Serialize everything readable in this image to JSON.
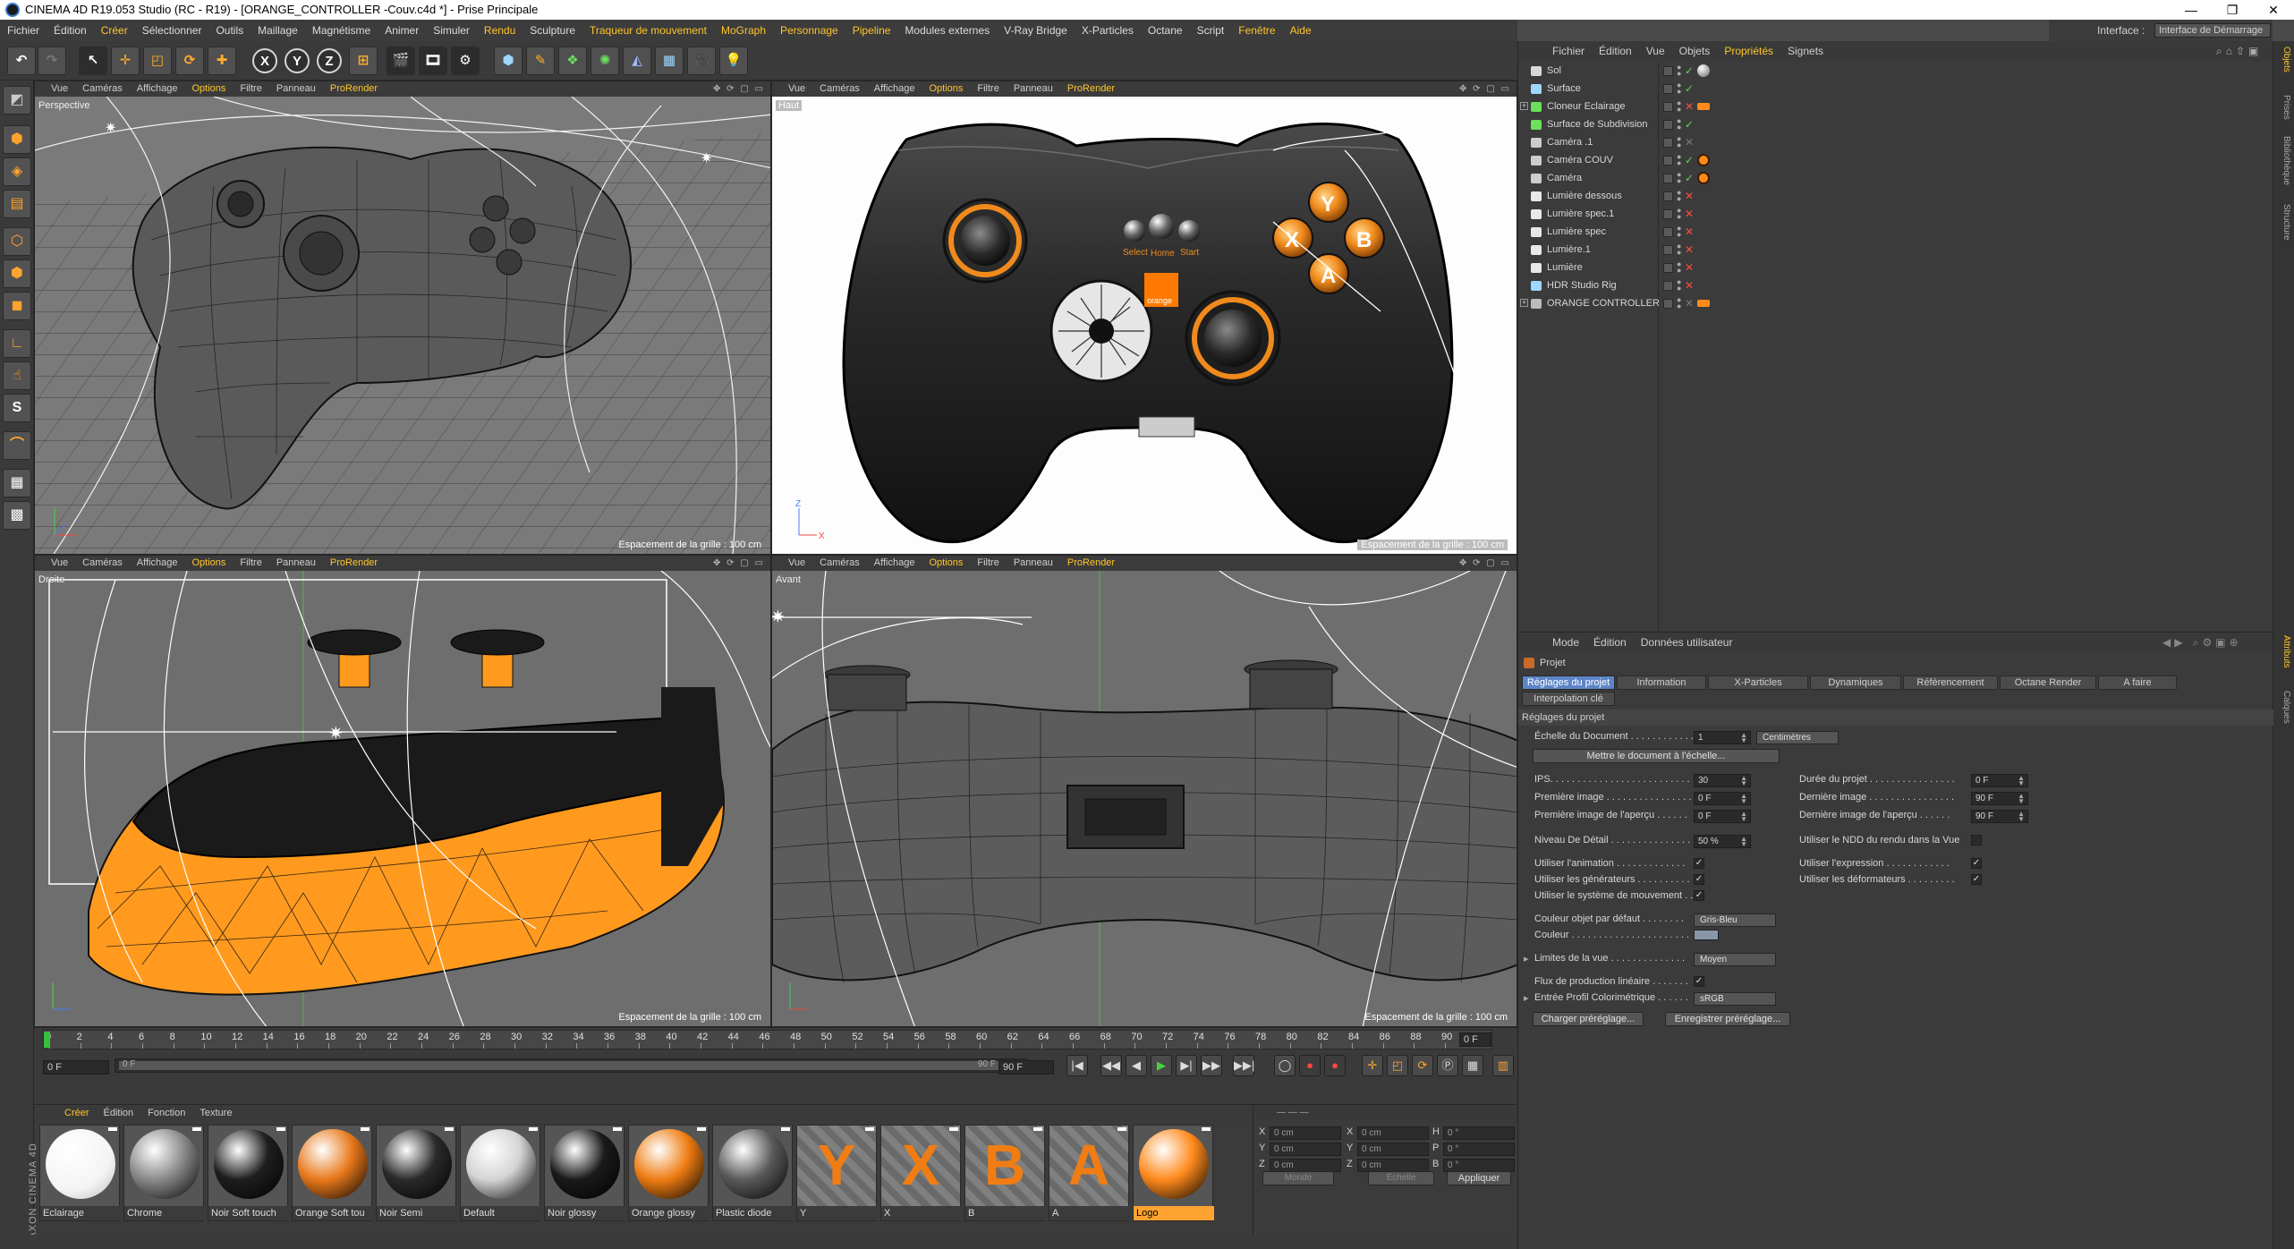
{
  "titlebar": {
    "title": "CINEMA 4D R19.053 Studio (RC - R19) - [ORANGE_CONTROLLER -Couv.c4d *] - Prise Principale",
    "min": "—",
    "restore": "❐",
    "close": "✕"
  },
  "menu": {
    "items": [
      "Fichier",
      "Édition",
      "Créer",
      "Sélectionner",
      "Outils",
      "Maillage",
      "Magnétisme",
      "Animer",
      "Simuler",
      "Rendu",
      "Sculpture",
      "Traqueur de mouvement",
      "MoGraph",
      "Personnage",
      "Pipeline",
      "Modules externes",
      "V-Ray Bridge",
      "X-Particles",
      "Octane",
      "Script",
      "Fenêtre",
      "Aide"
    ],
    "interface_label": "Interface :",
    "interface_value": "Interface de Démarrage"
  },
  "toolbar": {
    "icons": [
      "undo-icon",
      "redo-icon",
      "select-icon",
      "move-icon",
      "scale-icon",
      "rotate-icon",
      "recent-tool-icon",
      "x-axis-icon",
      "y-axis-icon",
      "z-axis-icon",
      "coord-system-icon",
      "render-view-icon",
      "render-picture-viewer-icon",
      "render-settings-icon",
      "cube-icon",
      "pen-icon",
      "subdivision-icon",
      "array-icon",
      "deformer-icon",
      "floor-icon",
      "camera-icon",
      "light-icon"
    ],
    "axis_labels": [
      "X",
      "Y",
      "Z"
    ]
  },
  "lefttools": {
    "icons": [
      "make-editable-icon",
      "model-mode-icon",
      "texture-mode-icon",
      "workplane-icon",
      "points-mode-icon",
      "edges-mode-icon",
      "polygons-mode-icon",
      "axis-mode-icon",
      "tweak-mode-icon",
      "solo-icon",
      "snap-icon",
      "enable-axis-icon",
      "locked-workplane-icon"
    ]
  },
  "viewports": {
    "menu": [
      "Vue",
      "Caméras",
      "Affichage",
      "Options",
      "Filtre",
      "Panneau",
      "ProRender"
    ],
    "controls": "✥ ⟳ ▢ ▭",
    "grid_label": "Espacement de la grille : 100 cm",
    "views": [
      {
        "name": "Perspective"
      },
      {
        "name": "Haut"
      },
      {
        "name": "Droite"
      },
      {
        "name": "Avant"
      }
    ],
    "controller_labels": {
      "select": "Select",
      "home": "Home",
      "start": "Start",
      "brand": "orange",
      "y": "Y",
      "x": "X",
      "b": "B",
      "a": "A"
    },
    "axis": {
      "z": "Z",
      "x": "X",
      "y": "Y"
    }
  },
  "timeline": {
    "ticks": [
      "0",
      "2",
      "4",
      "6",
      "8",
      "10",
      "12",
      "14",
      "16",
      "18",
      "20",
      "22",
      "24",
      "26",
      "28",
      "30",
      "32",
      "34",
      "36",
      "38",
      "40",
      "42",
      "44",
      "46",
      "48",
      "50",
      "52",
      "54",
      "56",
      "58",
      "60",
      "62",
      "64",
      "66",
      "68",
      "70",
      "72",
      "74",
      "76",
      "78",
      "80",
      "82",
      "84",
      "86",
      "88",
      "90"
    ],
    "end_frame_field": "0 F",
    "current_frame": "0 F",
    "range_start": "0 F",
    "range_end": "90 F",
    "max_frame": "90 F",
    "transport": [
      "|◀",
      "◀◀",
      "◀",
      "▶",
      "▶|",
      "▶▶",
      "▶▶|"
    ]
  },
  "materials": {
    "menu": [
      "Créer",
      "Édition",
      "Fonction",
      "Texture"
    ],
    "items": [
      {
        "name": "Eclairage",
        "color": "#ffffff"
      },
      {
        "name": "Chrome",
        "color": "#8a8a8a"
      },
      {
        "name": "Noir Soft touch",
        "color": "#1e1e1e"
      },
      {
        "name": "Orange Soft tou",
        "color": "#e8791c"
      },
      {
        "name": "Noir Semi",
        "color": "#2a2a2a"
      },
      {
        "name": "Default",
        "color": "#d4d4d4"
      },
      {
        "name": "Noir glossy",
        "color": "#1a1a1a"
      },
      {
        "name": "Orange glossy",
        "color": "#ef7d13"
      },
      {
        "name": "Plastic diode",
        "color": "#5a5a5a"
      },
      {
        "name": "Y",
        "color": "#f07d14"
      },
      {
        "name": "X",
        "color": "#f07d14"
      },
      {
        "name": "B",
        "color": "#f07d14"
      },
      {
        "name": "A",
        "color": "#f07d14"
      },
      {
        "name": "Logo",
        "color": "#ff8a1c"
      }
    ]
  },
  "coords": {
    "rows": [
      {
        "a": "X",
        "av": "0 cm",
        "b": "X",
        "bv": "0 cm",
        "c": "H",
        "cv": "0 °"
      },
      {
        "a": "Y",
        "av": "0 cm",
        "b": "Y",
        "bv": "0 cm",
        "c": "P",
        "cv": "0 °"
      },
      {
        "a": "Z",
        "av": "0 cm",
        "b": "Z",
        "bv": "0 cm",
        "c": "B",
        "cv": "0 °"
      }
    ],
    "mode": "Monde",
    "scale": "Échelle",
    "apply": "Appliquer"
  },
  "maxon": "MAXON CINEMA 4D",
  "objects": {
    "menu": [
      "Fichier",
      "Édition",
      "Vue",
      "Objets",
      "Propriétés",
      "Signets"
    ],
    "rows": [
      {
        "name": "Sol",
        "icon": "floor-icon",
        "state": "on",
        "tag": "sphere"
      },
      {
        "name": "Surface",
        "icon": "plane-icon",
        "state": "on",
        "tag": ""
      },
      {
        "name": "Cloneur Eclairage",
        "icon": "cloner-icon",
        "state": "off",
        "tag": "orange",
        "expand": "+"
      },
      {
        "name": "Surface de Subdivision",
        "icon": "subdivision-icon",
        "state": "on",
        "tag": ""
      },
      {
        "name": "Caméra .1",
        "icon": "camera-icon",
        "state": "grey",
        "tag": ""
      },
      {
        "name": "Caméra COUV",
        "icon": "camera-icon",
        "state": "on",
        "tag": "target"
      },
      {
        "name": "Caméra",
        "icon": "camera-icon",
        "state": "on",
        "tag": "target"
      },
      {
        "name": "Lumière dessous",
        "icon": "light-icon",
        "state": "off",
        "tag": ""
      },
      {
        "name": "Lumière spec.1",
        "icon": "light-icon",
        "state": "off",
        "tag": ""
      },
      {
        "name": "Lumière spec",
        "icon": "light-icon",
        "state": "off",
        "tag": ""
      },
      {
        "name": "Lumière.1",
        "icon": "light-icon",
        "state": "off",
        "tag": ""
      },
      {
        "name": "Lumière",
        "icon": "light-icon",
        "state": "off",
        "tag": ""
      },
      {
        "name": "HDR Studio Rig",
        "icon": "hdr-icon",
        "state": "off",
        "tag": ""
      },
      {
        "name": "ORANGE CONTROLLER",
        "icon": "null-icon",
        "state": "grey",
        "tag": "orange",
        "expand": "+"
      }
    ]
  },
  "rightrail": [
    "Objets",
    "Prises",
    "Bibliothèque",
    "Structure",
    "Attributs",
    "Calques"
  ],
  "attributes": {
    "menu": [
      "Mode",
      "Édition",
      "Données utilisateur"
    ],
    "header": "Projet",
    "tabs": [
      "Réglages du projet",
      "Information",
      "X-Particles",
      "Dynamiques",
      "Référencement",
      "Octane Render",
      "A faire"
    ],
    "tab2": "Interpolation clé",
    "section": "Réglages du projet",
    "doc_scale_label": "Échelle du Document . . . . . . . . . . . .",
    "doc_scale_value": "1",
    "doc_scale_unit": "Centimètres",
    "scale_btn": "Mettre le document à l'échelle...",
    "ips_label": "IPS. . . . . . . . . . . . . . . . . . . . . . . . . .",
    "ips_value": "30",
    "first_label": "Première image . . . . . . . . . . . . . . . .",
    "first_value": "0 F",
    "first_preview_label": "Première image de l'aperçu . . . . . .",
    "first_preview_value": "0 F",
    "duration_label": "Durée du projet . . . . . . . . . . . . . . . .",
    "duration_value": "0 F",
    "last_label": "Dernière image . . . . . . . . . . . . . . . .",
    "last_value": "90 F",
    "last_preview_label": "Dernière image de l'aperçu . . . . . .",
    "last_preview_value": "90 F",
    "lod_label": "Niveau De Détail . . . . . . . . . . . . . . .",
    "lod_value": "50 %",
    "lod_render_label": "Utiliser le NDD du rendu dans la Vue",
    "anim_label": "Utiliser l'animation . . . . . . . . . . . . .",
    "expr_label": "Utiliser l'expression . . . . . . . . . . . .",
    "gen_label": "Utiliser les générateurs . . . . . . . . . .",
    "def_label": "Utiliser les déformateurs . . . . . . . . .",
    "motion_label": "Utiliser le système de mouvement . .",
    "objcolor_label": "Couleur objet par défaut . . . . . . . .",
    "objcolor_value": "Gris-Bleu",
    "color_label": "Couleur . . . . . . . . . . . . . . . . . . . . . .",
    "view_limits_label": "Limites de la vue . . . . . . . . . . . . . .",
    "view_limits_value": "Moyen",
    "linear_label": "Flux de production linéaire . . . . . . .",
    "profile_label": "Entrée Profil Colorimétrique . . . . . .",
    "profile_value": "sRGB",
    "load_btn": "Charger préréglage...",
    "save_btn": "Enregistrer préréglage...",
    "check": "✓"
  }
}
